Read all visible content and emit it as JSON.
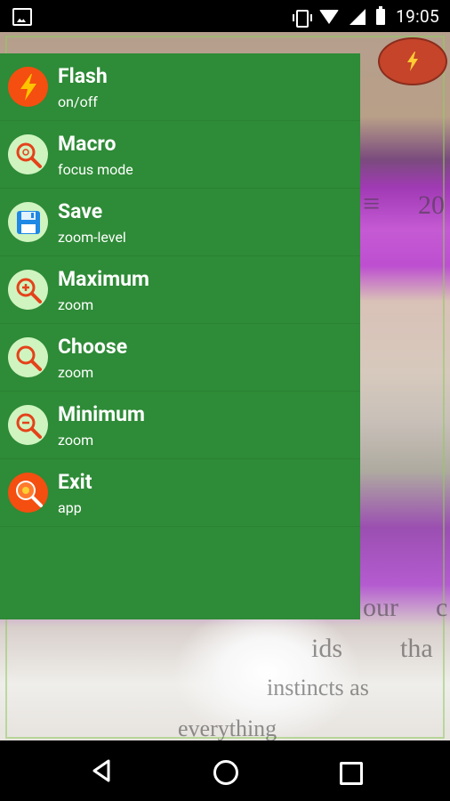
{
  "status_bar": {
    "time": "19:05",
    "icons": [
      "image-icon",
      "vibrate-icon",
      "wifi-icon",
      "signal-icon",
      "battery-icon"
    ]
  },
  "camera": {
    "visible_text": [
      "≡",
      "20",
      "our",
      "c",
      "ids",
      "tha",
      "instincts as",
      "everything"
    ]
  },
  "flash_button": {
    "icon": "lightning-icon"
  },
  "menu": {
    "items": [
      {
        "title": "Flash",
        "subtitle": "on/off",
        "icon": "flash-icon",
        "icon_bg": "#f44e10"
      },
      {
        "title": "Macro",
        "subtitle": "focus mode",
        "icon": "macro-magnifier-icon",
        "icon_bg": "#cff4c0"
      },
      {
        "title": "Save",
        "subtitle": "zoom-level",
        "icon": "floppy-disk-icon",
        "icon_bg": "#cff4c0"
      },
      {
        "title": "Maximum",
        "subtitle": "zoom",
        "icon": "zoom-in-icon",
        "icon_bg": "#cff4c0"
      },
      {
        "title": "Choose",
        "subtitle": "zoom",
        "icon": "magnifier-icon",
        "icon_bg": "#cff4c0"
      },
      {
        "title": "Minimum",
        "subtitle": "zoom",
        "icon": "zoom-out-icon",
        "icon_bg": "#cff4c0"
      },
      {
        "title": "Exit",
        "subtitle": "app",
        "icon": "exit-magnifier-icon",
        "icon_bg": "#f44e10"
      }
    ]
  },
  "colors": {
    "menu_background": "#2e8b37",
    "accent_red": "#f44e10",
    "icon_light_bg": "#cff4c0",
    "flash_fab": "#c5442a"
  },
  "nav_bar": {
    "buttons": [
      "back-icon",
      "home-icon",
      "recents-icon"
    ]
  }
}
